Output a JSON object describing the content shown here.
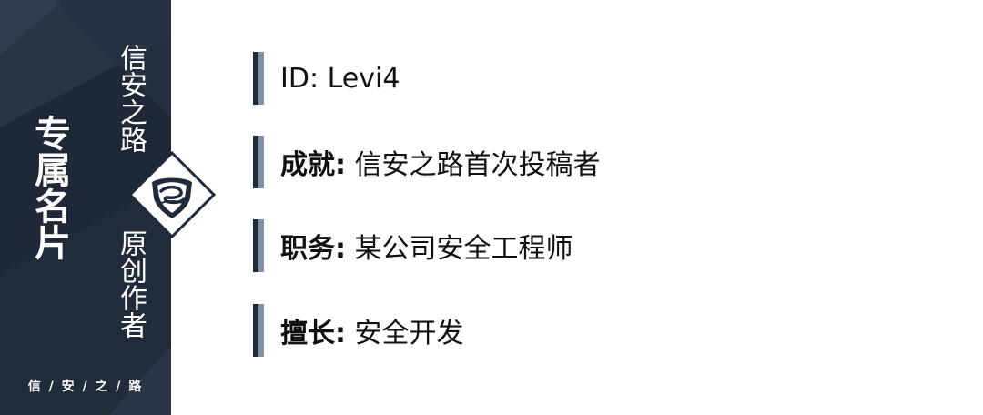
{
  "sidebar": {
    "title": "专属名片",
    "label_top": "信安之路",
    "label_bottom": "原创作者",
    "brand": "信 / 安 / 之 / 路",
    "colors": {
      "base": "#1e2836",
      "shade_light": "#2a3647",
      "shade_mid": "#253143",
      "logo_border": "#1f2a3c"
    },
    "logo_icon": "shield-logo-icon"
  },
  "rows": [
    {
      "label": "ID:",
      "value": "Levi4"
    },
    {
      "label": "成就:",
      "value": "信安之路首次投稿者"
    },
    {
      "label": "职务:",
      "value": "某公司安全工程师"
    },
    {
      "label": "擅长:",
      "value": "安全开发"
    }
  ],
  "accent": {
    "bar_dark": "#1f2a3c",
    "bar_light": "#8090a6"
  }
}
